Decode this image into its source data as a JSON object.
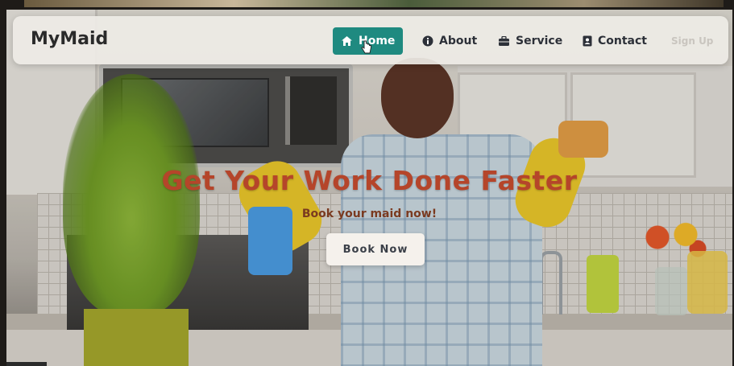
{
  "brand": "MyMaid",
  "nav": {
    "home": "Home",
    "about": "About",
    "service": "Service",
    "contact": "Contact",
    "signup": "Sign Up"
  },
  "hero": {
    "title": "Get Your Work Done Faster",
    "subtitle": "Book your maid now!",
    "cta": "Book Now"
  },
  "icons": {
    "home": "home-icon",
    "about": "info-icon",
    "service": "briefcase-icon",
    "contact": "contact-card-icon"
  },
  "colors": {
    "accent": "#1f8a80",
    "hero_title": "#b5452a",
    "navbar_bg": "#eeebe6"
  }
}
